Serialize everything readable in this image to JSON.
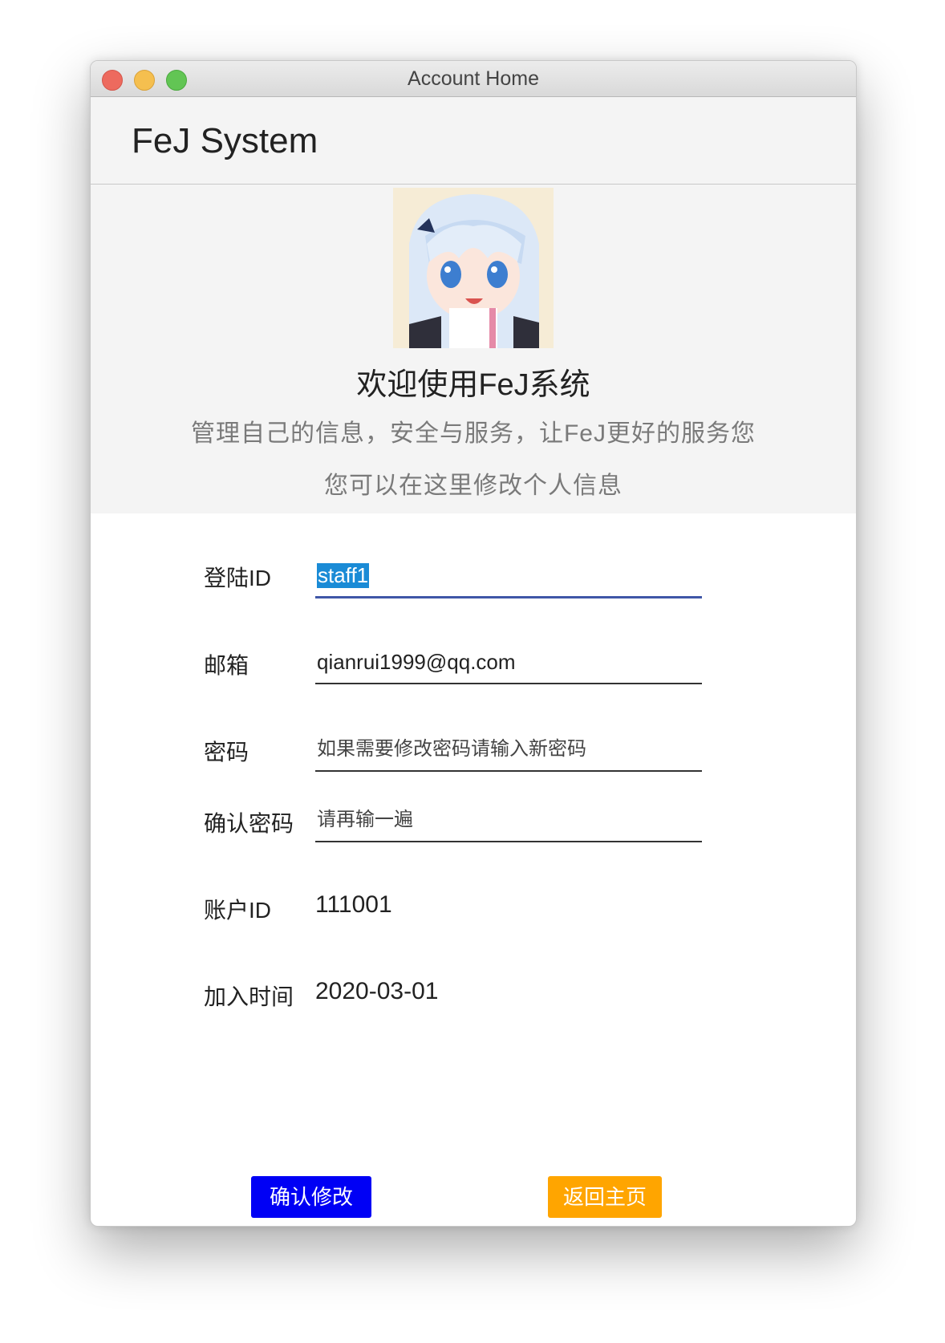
{
  "window": {
    "title": "Account Home"
  },
  "app": {
    "name": "FeJ System"
  },
  "hero": {
    "welcome": "欢迎使用FeJ系统",
    "subtitle": "管理自己的信息，安全与服务，让FeJ更好的服务您",
    "note": "您可以在这里修改个人信息"
  },
  "form": {
    "login_id": {
      "label": "登陆ID",
      "value": "staff1"
    },
    "email": {
      "label": "邮箱",
      "value": "qianrui1999@qq.com"
    },
    "password": {
      "label": "密码",
      "placeholder": "如果需要修改密码请输入新密码"
    },
    "confirm_password": {
      "label": "确认密码",
      "placeholder": "请再输一遍"
    },
    "account_id": {
      "label": "账户ID",
      "value": "111001"
    },
    "join_time": {
      "label": "加入时间",
      "value": "2020-03-01"
    }
  },
  "buttons": {
    "confirm": "确认修改",
    "home": "返回主页"
  },
  "colors": {
    "confirm_button": "#0000f5",
    "home_button": "#ffa500",
    "focus_underline": "#3f57a7",
    "selection": "#1a8bd6"
  }
}
